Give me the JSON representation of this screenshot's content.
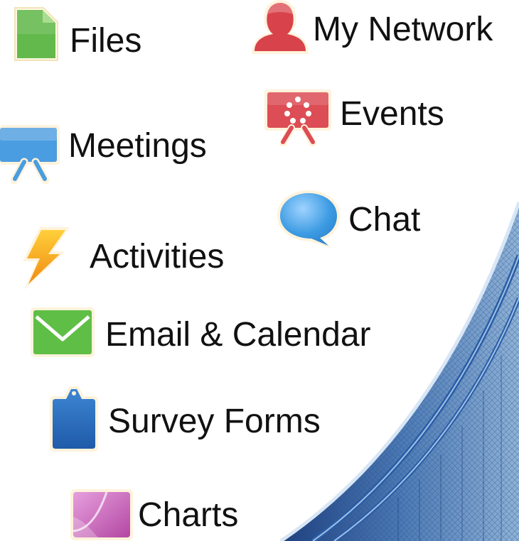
{
  "items": [
    {
      "label": "Files",
      "icon": "file-icon",
      "color": "#5fb84c"
    },
    {
      "label": "My Network",
      "icon": "person-icon",
      "color": "#d9464c"
    },
    {
      "label": "Events",
      "icon": "presentation-board-icon",
      "color": "#dd5058"
    },
    {
      "label": "Meetings",
      "icon": "presentation-screen-icon",
      "color": "#4a9ee0"
    },
    {
      "label": "Chat",
      "icon": "speech-bubble-icon",
      "color": "#3e9ee4"
    },
    {
      "label": "Activities",
      "icon": "lightning-icon",
      "color": "#f2a21c"
    },
    {
      "label": "Email & Calendar",
      "icon": "envelope-icon",
      "color": "#5fbf45"
    },
    {
      "label": "Survey Forms",
      "icon": "clipboard-icon",
      "color": "#2b6fc2"
    },
    {
      "label": "Charts",
      "icon": "chart-card-icon",
      "color": "#c65cb6"
    }
  ],
  "background": {
    "corner_image": "bridge-cables-photo"
  }
}
